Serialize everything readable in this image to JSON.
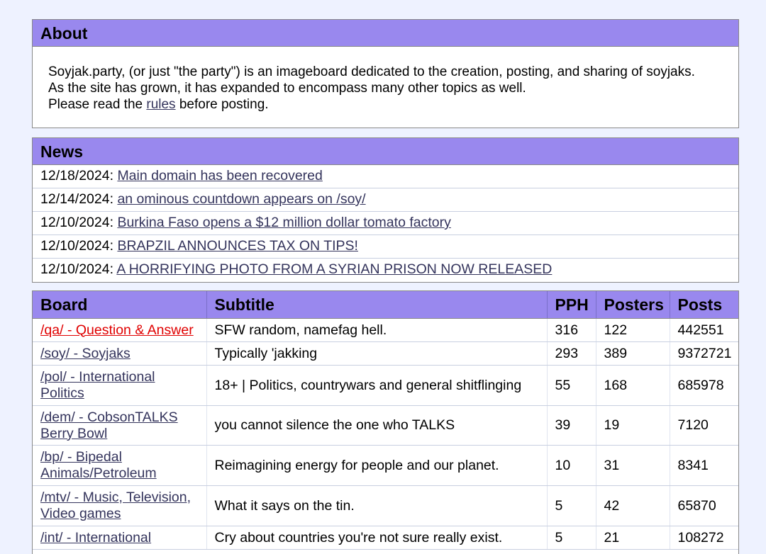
{
  "about": {
    "title": "About",
    "line1": "Soyjak.party, (or just \"the party\") is an imageboard dedicated to the creation, posting, and sharing of soyjaks.",
    "line2": "As the site has grown, it has expanded to encompass many other topics as well.",
    "line3_before": "Please read the ",
    "rules_link": "rules",
    "line3_after": " before posting."
  },
  "news": {
    "title": "News",
    "items": [
      {
        "date": "12/18/2024:",
        "headline": "Main domain has been recovered"
      },
      {
        "date": "12/14/2024:",
        "headline": "an ominous countdown appears on /soy/"
      },
      {
        "date": "12/10/2024:",
        "headline": "Burkina Faso opens a $12 million dollar tomato factory"
      },
      {
        "date": "12/10/2024:",
        "headline": "BRAPZIL ANNOUNCES TAX ON TIPS!"
      },
      {
        "date": "12/10/2024:",
        "headline": "A HORRIFYING PHOTO FROM A SYRIAN PRISON NOW RELEASED"
      }
    ]
  },
  "boards": {
    "columns": [
      "Board",
      "Subtitle",
      "PPH",
      "Posters",
      "Posts"
    ],
    "rows": [
      {
        "board": "/qa/ - Question & Answer",
        "subtitle": "SFW random, namefag hell.",
        "pph": "316",
        "posters": "122",
        "posts": "442551",
        "highlight": true
      },
      {
        "board": "/soy/ - Soyjaks",
        "subtitle": "Typically 'jakking",
        "pph": "293",
        "posters": "389",
        "posts": "9372721"
      },
      {
        "board": "/pol/ - International Politics",
        "subtitle": "18+ | Politics, countrywars and general shitflinging",
        "pph": "55",
        "posters": "168",
        "posts": "685978"
      },
      {
        "board": "/dem/ - CobsonTALKS Berry Bowl",
        "subtitle": "you cannot silence the one who TALKS",
        "pph": "39",
        "posters": "19",
        "posts": "7120"
      },
      {
        "board": "/bp/ - Bipedal Animals/Petroleum",
        "subtitle": "Reimagining energy for people and our planet.",
        "pph": "10",
        "posters": "31",
        "posts": "8341"
      },
      {
        "board": "/mtv/ - Music, Television, Video games",
        "subtitle": "What it says on the tin.",
        "pph": "5",
        "posters": "42",
        "posts": "65870"
      },
      {
        "board": "/int/ - International",
        "subtitle": "Cry about countries you're not sure really exist.",
        "pph": "5",
        "posters": "21",
        "posts": "108272"
      }
    ]
  }
}
